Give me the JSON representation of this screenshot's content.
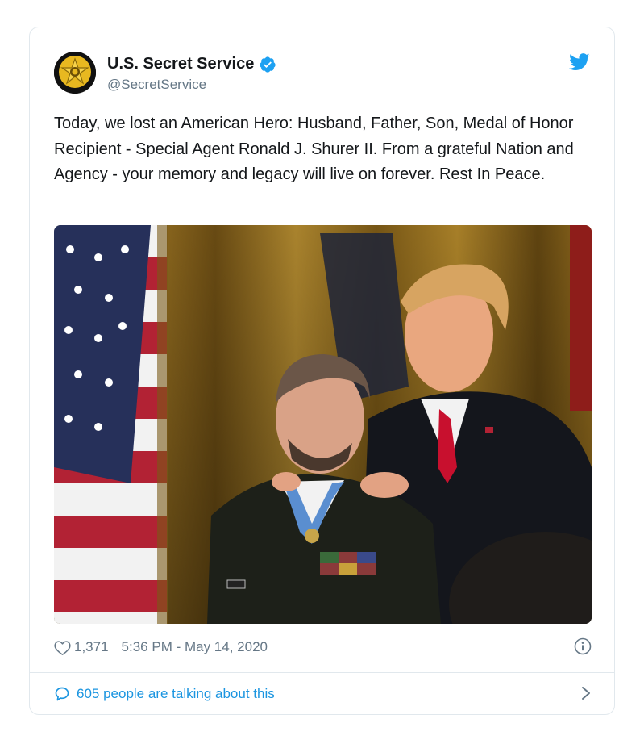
{
  "colors": {
    "brand_blue": "#1DA1F2",
    "link_blue": "#1b95e0",
    "text_primary": "#14171a",
    "text_secondary": "#657786",
    "border": "#e1e8ed"
  },
  "tweet": {
    "author": {
      "display_name": "U.S. Secret Service",
      "handle": "@SecretService",
      "verified": true,
      "avatar_icon": "secret-service-star-badge"
    },
    "text": "Today, we lost an American Hero: Husband, Father, Son, Medal of Honor Recipient - Special Agent Ronald J. Shurer II. From a grateful Nation and Agency - your memory and legacy will live on forever. Rest In Peace.",
    "media": {
      "type": "photo"
    },
    "likes": "1,371",
    "timestamp": "5:36 PM - May 14, 2020",
    "conversation_text": "605 people are talking about this"
  },
  "icons": {
    "platform": "twitter-bird-icon",
    "like": "heart-icon",
    "info": "info-icon",
    "reply": "speech-bubble-icon",
    "chevron": "chevron-right-icon"
  }
}
